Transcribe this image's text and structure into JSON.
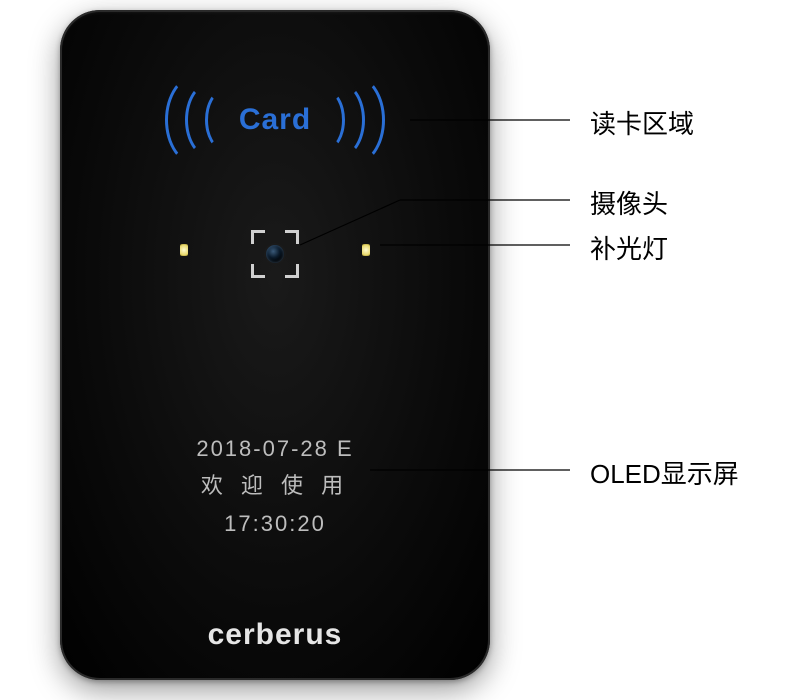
{
  "device": {
    "card_label": "Card",
    "brand": "cerberus",
    "screen": {
      "date": "2018-07-28 E",
      "welcome": "欢 迎 使 用",
      "time": "17:30:20"
    }
  },
  "callouts": {
    "card_area": "读卡区域",
    "camera": "摄像头",
    "led": "补光灯",
    "oled": "OLED显示屏"
  }
}
